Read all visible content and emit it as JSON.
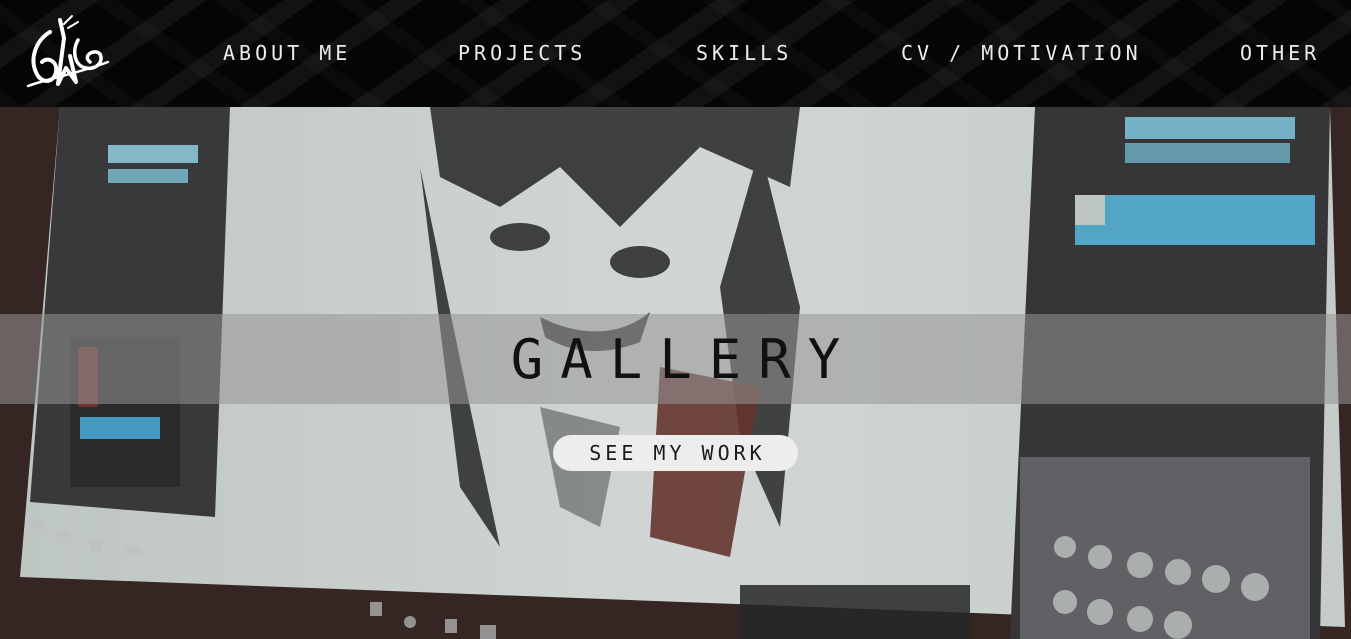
{
  "header": {
    "logo_name": "signature-logo",
    "nav": [
      {
        "label": "ABOUT ME"
      },
      {
        "label": "PROJECTS"
      },
      {
        "label": "SKILLS"
      },
      {
        "label": "CV / MOTIVATION"
      },
      {
        "label": "OTHER"
      }
    ]
  },
  "hero": {
    "title": "GALLERY",
    "cta_label": "SEE MY WORK"
  }
}
